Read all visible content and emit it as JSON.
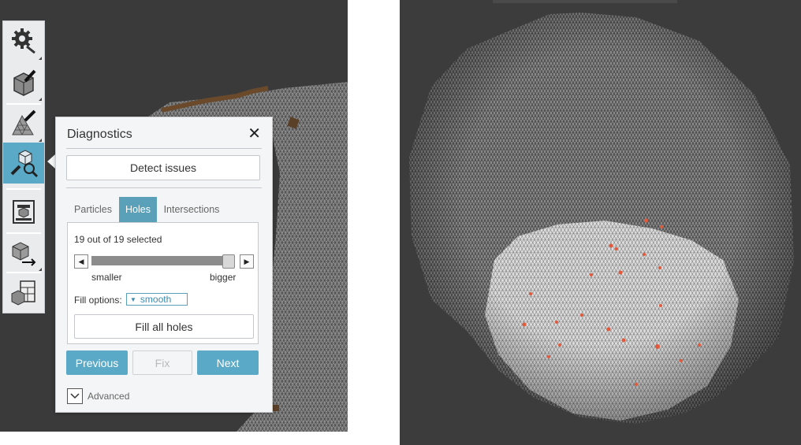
{
  "panel": {
    "title": "Diagnostics",
    "close_label": "✕",
    "detect_label": "Detect issues",
    "tabs": [
      {
        "label": "Particles",
        "active": false
      },
      {
        "label": "Holes",
        "active": true
      },
      {
        "label": "Intersections",
        "active": false
      }
    ],
    "selection_text": "19 out of 19 selected",
    "slider": {
      "min_label": "smaller",
      "max_label": "bigger",
      "value_fraction": 1.0
    },
    "fill_options_label": "Fill options:",
    "fill_option_selected": "smooth",
    "fill_all_label": "Fill all holes",
    "previous_label": "Previous",
    "fix_label": "Fix",
    "next_label": "Next",
    "advanced_label": "Advanced"
  },
  "toolbar": {
    "tools": [
      {
        "name": "settings-tool",
        "icon": "gear-wrench-icon"
      },
      {
        "name": "sculpt-tool",
        "icon": "cube-brush-icon"
      },
      {
        "name": "mesh-tool",
        "icon": "mesh-brush-icon"
      },
      {
        "name": "analysis-tool",
        "icon": "cube-wrench-magnifier-icon",
        "active": true
      },
      {
        "name": "print-tool",
        "icon": "print-bed-icon"
      },
      {
        "name": "export-tool",
        "icon": "cube-arrow-icon"
      },
      {
        "name": "layout-tool",
        "icon": "cube-grid-icon"
      }
    ]
  },
  "colors": {
    "accent": "#5aa9c6",
    "hole_marker": "#e2593b",
    "viewport_bg": "#3a3a3a"
  }
}
